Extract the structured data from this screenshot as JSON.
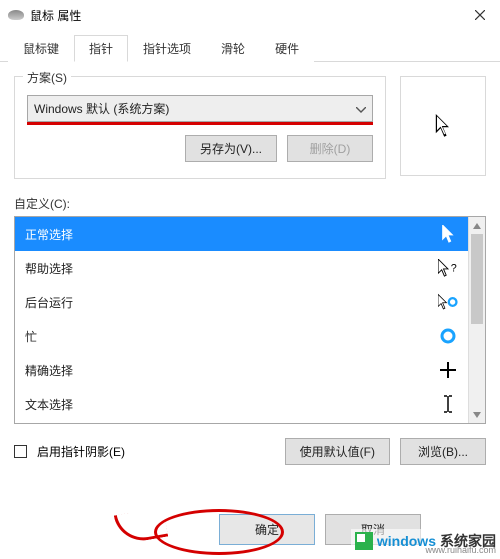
{
  "window": {
    "title": "鼠标 属性"
  },
  "tabs": {
    "items": [
      {
        "label": "鼠标键"
      },
      {
        "label": "指针"
      },
      {
        "label": "指针选项"
      },
      {
        "label": "滑轮"
      },
      {
        "label": "硬件"
      }
    ],
    "active_index": 1
  },
  "scheme": {
    "legend": "方案(S)",
    "selected": "Windows 默认 (系统方案)",
    "save_as_label": "另存为(V)...",
    "delete_label": "删除(D)"
  },
  "customize": {
    "label": "自定义(C):",
    "items": [
      {
        "label": "正常选择",
        "icon": "arrow",
        "selected": true
      },
      {
        "label": "帮助选择",
        "icon": "arrow-help",
        "selected": false
      },
      {
        "label": "后台运行",
        "icon": "arrow-busy",
        "selected": false
      },
      {
        "label": "忙",
        "icon": "busy",
        "selected": false
      },
      {
        "label": "精确选择",
        "icon": "cross",
        "selected": false
      },
      {
        "label": "文本选择",
        "icon": "ibeam",
        "selected": false
      }
    ]
  },
  "options": {
    "shadow_label": "启用指针阴影(E)",
    "shadow_checked": false,
    "use_default_label": "使用默认值(F)",
    "browse_label": "浏览(B)..."
  },
  "dialog_buttons": {
    "ok": "确定",
    "cancel": "取消"
  },
  "watermark": {
    "brand1": "windows",
    "brand2": "系统家园",
    "url": "www.ruihaifu.com"
  }
}
